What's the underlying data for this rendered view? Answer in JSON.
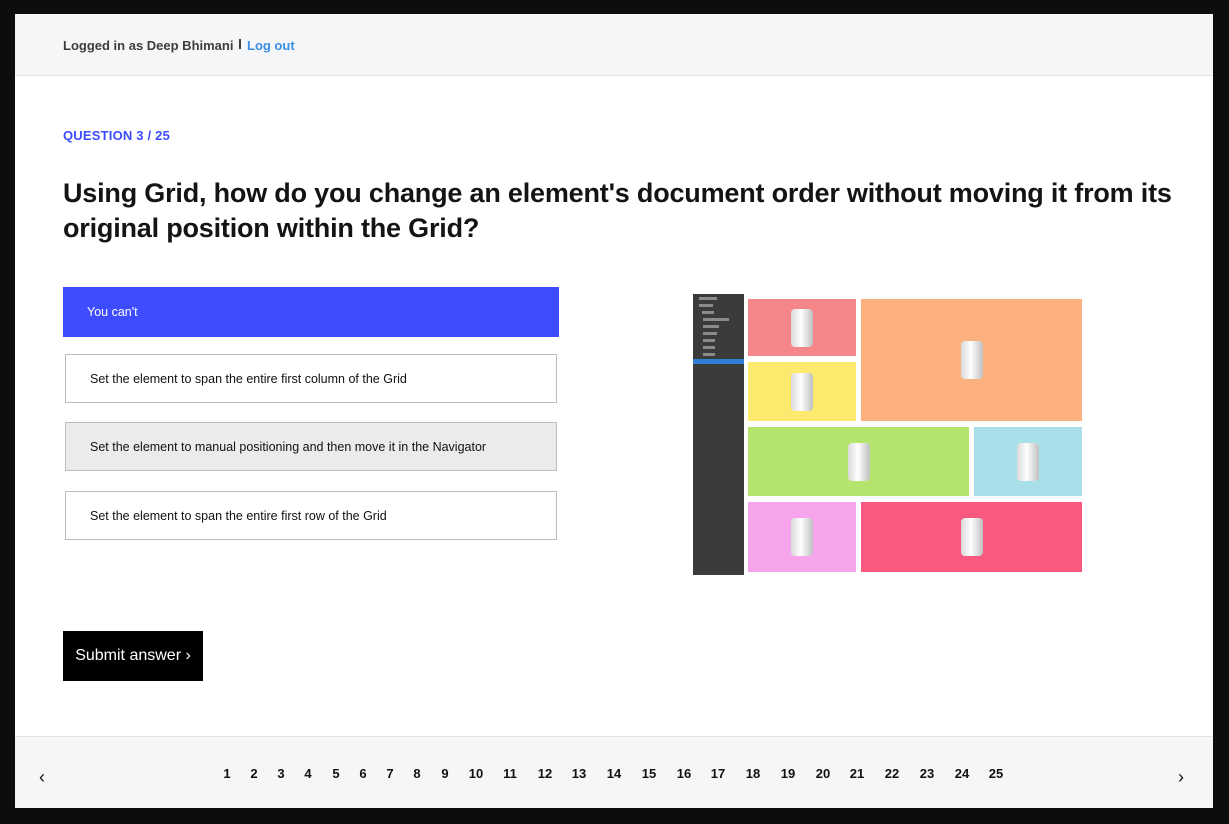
{
  "header": {
    "logged_in_text": "Logged in as Deep Bhimani",
    "logout_label": "Log out"
  },
  "question": {
    "number_label": "QUESTION 3 / 25",
    "text": "Using Grid, how do you change an element's document order without moving it from its original position within the Grid?"
  },
  "options": [
    {
      "label": "You can't",
      "state": "selected"
    },
    {
      "label": "Set the element to span the entire first column of the Grid",
      "state": "default"
    },
    {
      "label": "Set the element to manual positioning and then move it in the Navigator",
      "state": "hover"
    },
    {
      "label": "Set the element to span the entire first row of the Grid",
      "state": "default"
    }
  ],
  "submit_label": "Submit answer ›",
  "pagination": {
    "prev_icon": "‹",
    "next_icon": "›",
    "pages": [
      "1",
      "2",
      "3",
      "4",
      "5",
      "6",
      "7",
      "8",
      "9",
      "10",
      "11",
      "12",
      "13",
      "14",
      "15",
      "16",
      "17",
      "18",
      "19",
      "20",
      "21",
      "22",
      "23",
      "24",
      "25"
    ],
    "current": "3"
  },
  "colors": {
    "accent": "#3d4cff",
    "link": "#3a8ee6",
    "grid_cells": [
      "#f6868a",
      "#fbb07d",
      "#fbea6e",
      "#b4e46c",
      "#a9dfe9",
      "#f6a5ec",
      "#f9587f"
    ]
  }
}
